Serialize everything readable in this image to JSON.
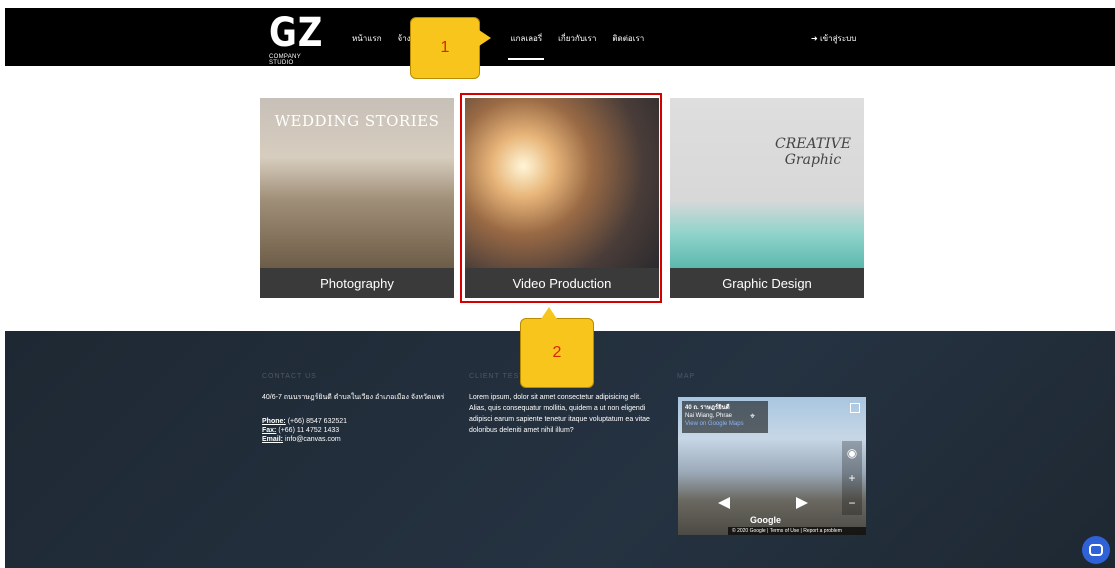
{
  "header": {
    "logo_mark": "GZ",
    "logo_sub": "COMPANY STUDIO",
    "nav": [
      {
        "label": "หน้าแรก"
      },
      {
        "label": "จ้างงาน"
      },
      {
        "label": "แกลเลอรี่"
      },
      {
        "label": "เกี่ยวกับเรา"
      },
      {
        "label": "ติดต่อเรา"
      }
    ],
    "login_label": "เข้าสู่ระบบ",
    "login_icon": "sign-in-icon"
  },
  "callouts": {
    "one": "1",
    "two": "2"
  },
  "gallery": [
    {
      "label": "Photography",
      "overlay": "WEDDING STORIES"
    },
    {
      "label": "Video Production"
    },
    {
      "label": "Graphic Design",
      "overlay": "CREATIVE Graphic"
    }
  ],
  "footer": {
    "contact": {
      "heading": "CONTACT US",
      "address": "40/6-7 ถนนราษฎร์ยินดี ตำบลในเวียง อำเภอเมือง จังหวัดแพร่",
      "phone_label": "Phone:",
      "phone": "(+66) 8547 632521",
      "fax_label": "Fax:",
      "fax": "(+66) 11 4752 1433",
      "email_label": "Email:",
      "email": "info@canvas.com"
    },
    "testimonials": {
      "heading": "CLIENT TESTIMONIALS",
      "text": "Lorem ipsum, dolor sit amet consectetur adipisicing elit. Alias, quis consequatur mollitia, quidem a ut non eligendi adipisci earum sapiente tenetur itaque voluptatum ea vitae doloribus deleniti amet nihil illum?"
    },
    "map": {
      "heading": "MAP",
      "location_title": "40 ถ. ราษฎร์ยินดี",
      "location_sub": "Nai Wiang, Phrae",
      "location_link": "View on Google Maps",
      "google": "Google",
      "footer_text": "© 2020 Google | Terms of Use | Report a problem"
    }
  },
  "colors": {
    "highlight": "#d40000",
    "callout": "#f7c51c",
    "chat": "#2f62d7"
  }
}
